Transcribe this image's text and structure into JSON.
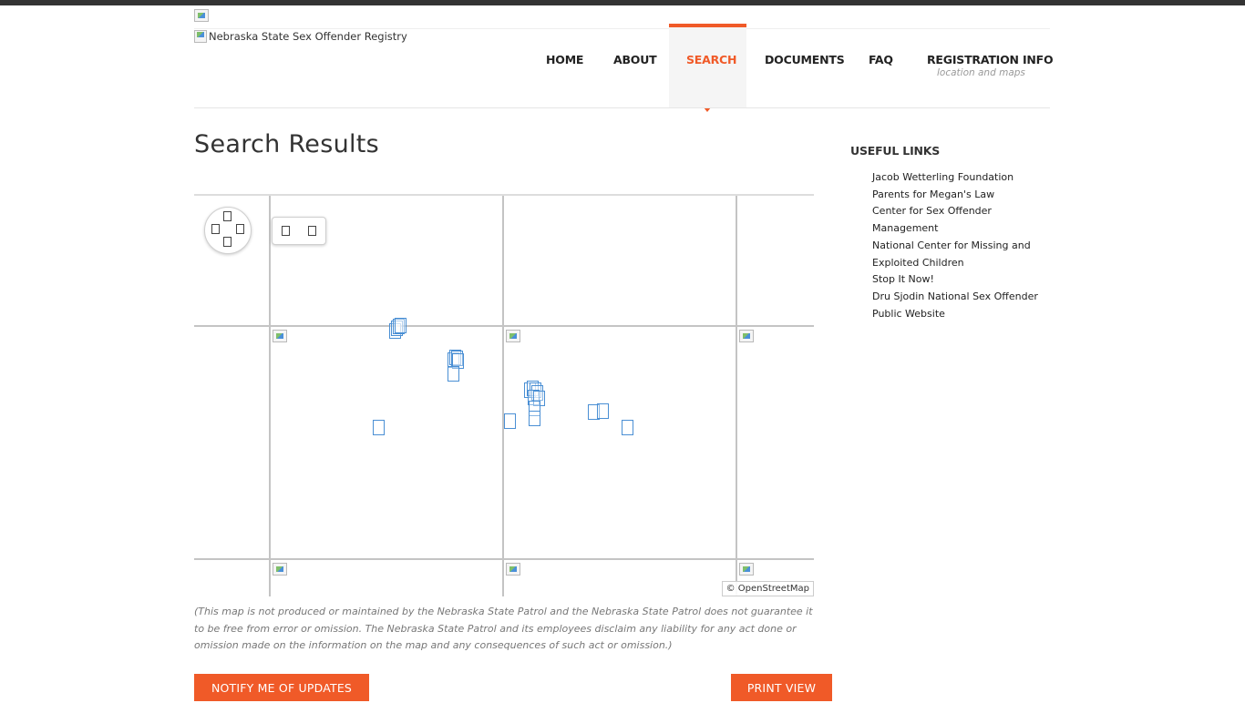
{
  "header": {
    "logo_alt": "Nebraska State Sex Offender Registry"
  },
  "nav": {
    "items": [
      "HOME",
      "ABOUT",
      "SEARCH",
      "DOCUMENTS",
      "FAQ",
      "REGISTRATION INFO"
    ],
    "active": "SEARCH",
    "registration_subtitle": "location and maps"
  },
  "main": {
    "title": "Search Results",
    "map_attribution": "© OpenStreetMap",
    "disclaimer": "(This map is not produced or maintained by the Nebraska State Patrol and the Nebraska State Patrol does not guarantee it to be free from error or omission. The Nebraska State Patrol and its employees disclaim any liability for any act done or omission made on the information on the map and any consequences of such act or omission.)",
    "notify_button": "NOTIFY ME OF UPDATES",
    "print_button": "PRINT VIEW"
  },
  "sidebar": {
    "heading": "USEFUL LINKS",
    "links": [
      "Jacob Wetterling Foundation",
      "Parents for Megan's Law",
      "Center for Sex Offender Management",
      "National Center for Missing and Exploited Children",
      "Stop It Now!",
      "Dru Sjodin National Sex Offender Public Website"
    ]
  },
  "colors": {
    "accent": "#f05a28",
    "marker": "#4a8fd4",
    "topbar": "#333333"
  },
  "icons": {
    "pan": "pan-arrows-icon",
    "zoom_in": "zoom-in-icon",
    "zoom_out": "zoom-out-icon",
    "marker": "map-marker-icon",
    "broken_image": "broken-image-icon"
  }
}
